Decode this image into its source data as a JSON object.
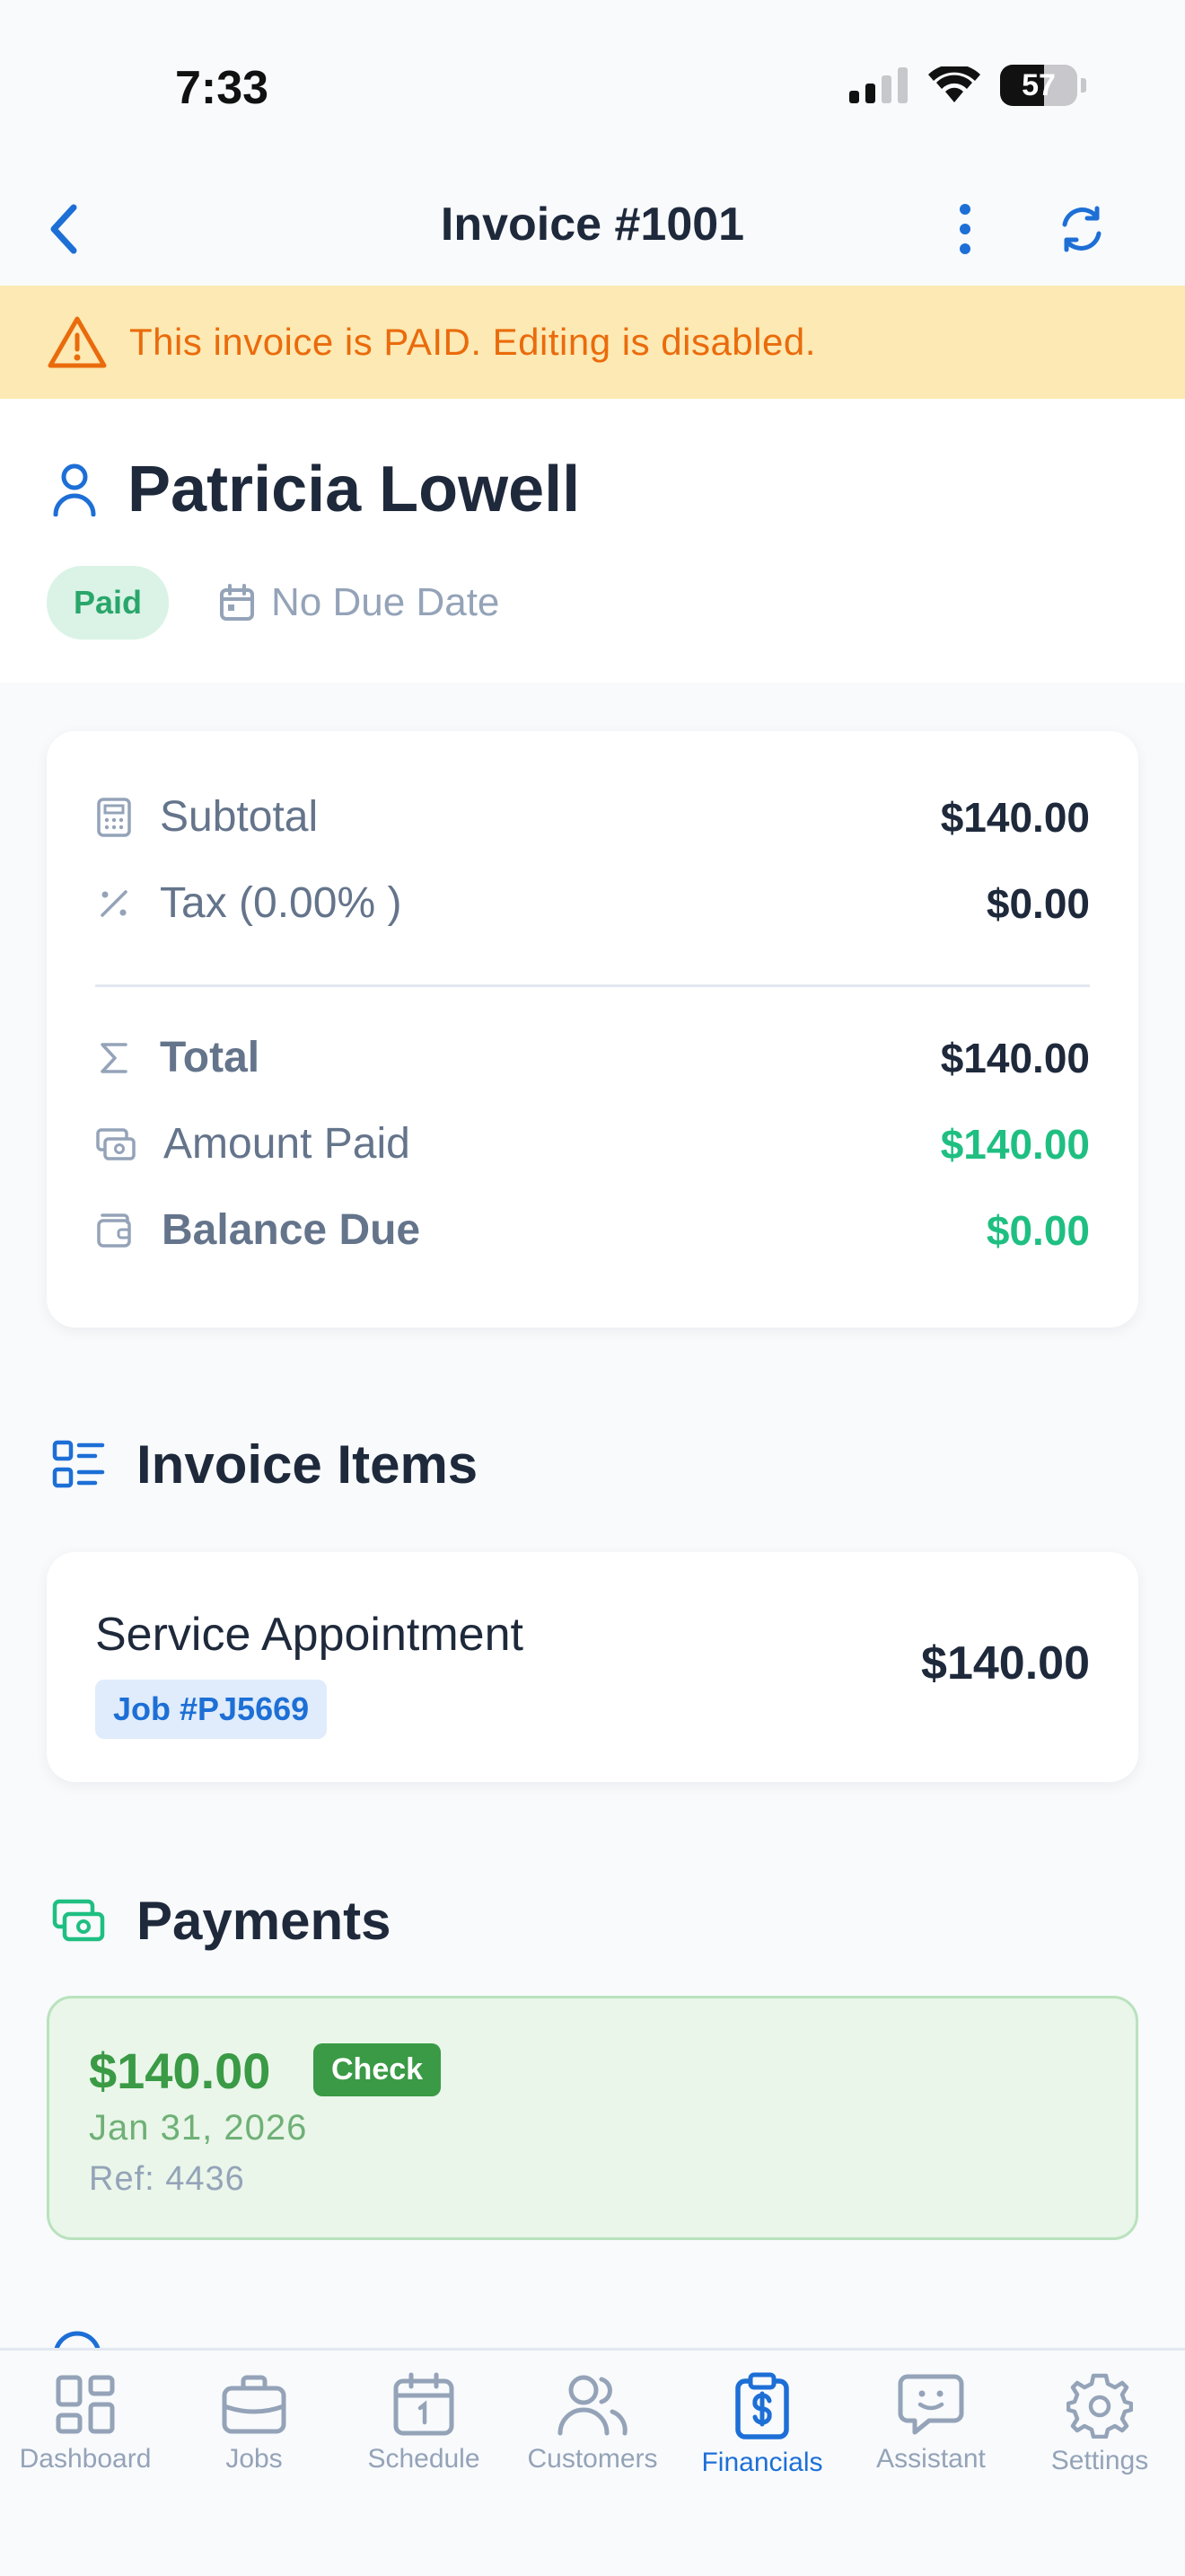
{
  "status_bar": {
    "time": "7:33",
    "battery": "57",
    "battery_fraction": 0.57
  },
  "nav": {
    "title": "Invoice #1001"
  },
  "banner": {
    "text": "This invoice is PAID. Editing is disabled."
  },
  "customer": {
    "name": "Patricia Lowell",
    "status": "Paid",
    "due_date": "No Due Date"
  },
  "summary": {
    "subtotal_label": "Subtotal",
    "subtotal": "$140.00",
    "tax_label": "Tax (0.00% )",
    "tax": "$0.00",
    "total_label": "Total",
    "total": "$140.00",
    "paid_label": "Amount Paid",
    "paid": "$140.00",
    "balance_label": "Balance Due",
    "balance": "$0.00"
  },
  "items": {
    "title": "Invoice Items",
    "list": [
      {
        "name": "Service Appointment",
        "job": "Job #PJ5669",
        "price": "$140.00"
      }
    ]
  },
  "payments": {
    "title": "Payments",
    "list": [
      {
        "amount": "$140.00",
        "method": "Check",
        "date": "Jan 31, 2026",
        "ref": "Ref: 4436"
      }
    ]
  },
  "tabs": [
    {
      "label": "Dashboard",
      "icon": "dashboard-icon"
    },
    {
      "label": "Jobs",
      "icon": "briefcase-icon"
    },
    {
      "label": "Schedule",
      "icon": "calendar-icon"
    },
    {
      "label": "Customers",
      "icon": "users-icon"
    },
    {
      "label": "Financials",
      "icon": "clipboard-dollar-icon",
      "active": true
    },
    {
      "label": "Assistant",
      "icon": "chat-smile-icon"
    },
    {
      "label": "Settings",
      "icon": "gear-icon"
    }
  ],
  "colors": {
    "accent": "#1d6fd6",
    "success": "#1fbf82",
    "warning": "#ea6b0c",
    "payment_green": "#3a9a45"
  }
}
